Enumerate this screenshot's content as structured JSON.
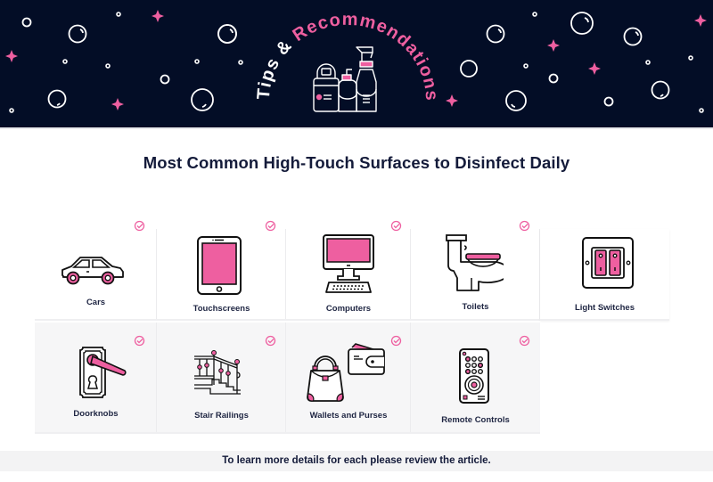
{
  "banner": {
    "title_part1": "Tips & ",
    "title_part2": "Recommendations",
    "icon": "cleaning-bottles-icon",
    "background_color": "#030d26",
    "accent_color": "#ee5fa0"
  },
  "page_title": "Most Common High-Touch Surfaces to Disinfect Daily",
  "surfaces": [
    {
      "label": "Cars",
      "icon": "car-icon",
      "checked": true
    },
    {
      "label": "Touchscreens",
      "icon": "tablet-icon",
      "checked": true
    },
    {
      "label": "Computers",
      "icon": "computer-icon",
      "checked": true
    },
    {
      "label": "Toilets",
      "icon": "toilet-icon",
      "checked": true
    },
    {
      "label": "Light Switches",
      "icon": "light-switch-icon",
      "checked": false
    },
    {
      "label": "Doorknobs",
      "icon": "door-handle-icon",
      "checked": true
    },
    {
      "label": "Stair Railings",
      "icon": "stair-railing-icon",
      "checked": true
    },
    {
      "label": "Wallets and Purses",
      "icon": "wallet-purse-icon",
      "checked": true
    },
    {
      "label": "Remote Controls",
      "icon": "remote-control-icon",
      "checked": true
    }
  ],
  "footer_text": "To learn more details for each please review the article."
}
